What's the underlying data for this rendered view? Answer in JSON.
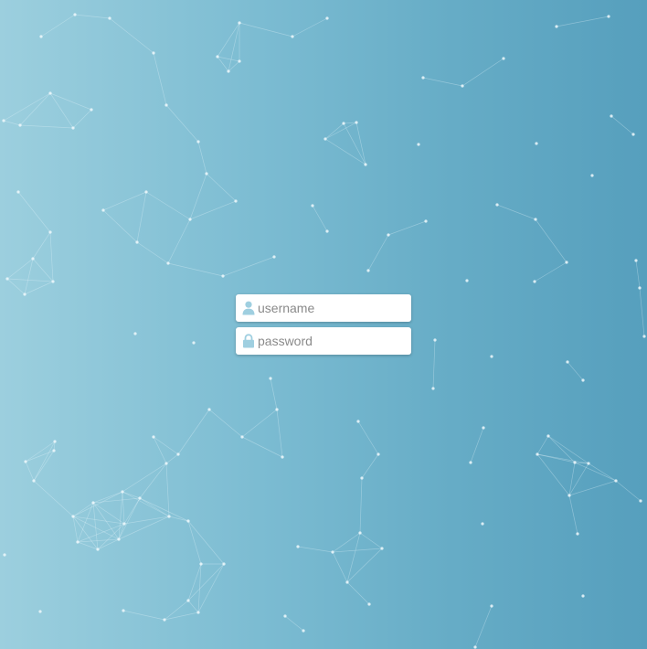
{
  "login": {
    "username": {
      "value": "",
      "placeholder": "username",
      "icon": "user-icon"
    },
    "password": {
      "value": "",
      "placeholder": "password",
      "icon": "lock-icon"
    }
  },
  "theme": {
    "background_gradient": [
      "#9ccfde",
      "#569fbd"
    ],
    "network_color": "#e8f6fb",
    "icon_color": "#9fcfe0"
  }
}
